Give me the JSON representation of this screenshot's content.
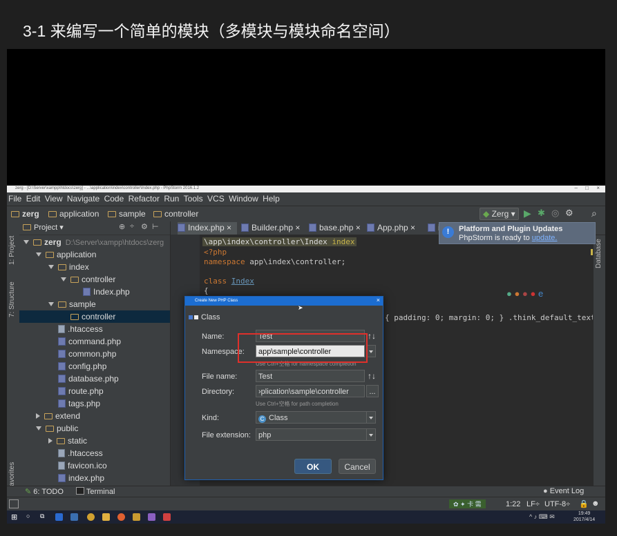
{
  "page_title": "3-1 来编写一个简单的模块（多模块与模块命名空间）",
  "ide": {
    "window_title": "zerg - [D:\\Server\\xampp\\htdocs\\zerg] - ...\\application\\index\\controller\\Index.php - PhpStorm 2016.1.2",
    "menu": [
      "File",
      "Edit",
      "View",
      "Navigate",
      "Code",
      "Refactor",
      "Run",
      "Tools",
      "VCS",
      "Window",
      "Help"
    ],
    "breadcrumb": [
      "zerg",
      "application",
      "sample",
      "controller"
    ],
    "run_config": "Zerg",
    "project_header": "Project",
    "side_tabs": {
      "project": "1: Project",
      "structure": "7: Structure",
      "favorites": "2: Favorites",
      "database": "Database"
    },
    "tree": [
      {
        "label": "zerg",
        "note": "D:\\Server\\xampp\\htdocs\\zerg",
        "kind": "folder",
        "depth": 0,
        "open": true
      },
      {
        "label": "application",
        "kind": "folder",
        "depth": 1,
        "open": true
      },
      {
        "label": "index",
        "kind": "folder",
        "depth": 2,
        "open": true
      },
      {
        "label": "controller",
        "kind": "folder",
        "depth": 3,
        "open": true
      },
      {
        "label": "Index.php",
        "kind": "php",
        "depth": 4
      },
      {
        "label": "sample",
        "kind": "folder",
        "depth": 2,
        "open": true
      },
      {
        "label": "controller",
        "kind": "folder",
        "depth": 3,
        "selected": true
      },
      {
        "label": ".htaccess",
        "kind": "file",
        "depth": 2
      },
      {
        "label": "command.php",
        "kind": "php",
        "depth": 2
      },
      {
        "label": "common.php",
        "kind": "php",
        "depth": 2
      },
      {
        "label": "config.php",
        "kind": "php",
        "depth": 2
      },
      {
        "label": "database.php",
        "kind": "php",
        "depth": 2
      },
      {
        "label": "route.php",
        "kind": "php",
        "depth": 2
      },
      {
        "label": "tags.php",
        "kind": "php",
        "depth": 2
      },
      {
        "label": "extend",
        "kind": "folder",
        "depth": 1,
        "open": false
      },
      {
        "label": "public",
        "kind": "folder",
        "depth": 1,
        "open": true
      },
      {
        "label": "static",
        "kind": "folder",
        "depth": 2,
        "open": false
      },
      {
        "label": ".htaccess",
        "kind": "file",
        "depth": 2
      },
      {
        "label": "favicon.ico",
        "kind": "file",
        "depth": 2
      },
      {
        "label": "index.php",
        "kind": "php",
        "depth": 2
      }
    ],
    "tabs": [
      "Index.php",
      "Builder.php",
      "base.php",
      "App.php",
      "in"
    ],
    "code": {
      "breadcrumb": "\\app\\index\\controller\\Index",
      "breadcrumb_method": "index",
      "line1": "<?php",
      "line2_kw": "namespace",
      "line2_rest": " app\\index\\controller;",
      "line3_kw": "class",
      "line3_name": "Index",
      "line4": "{",
      "css_line": "{ padding: 0; margin: 0; } .think_default_text{ p"
    },
    "notification": {
      "title": "Platform and Plugin Updates",
      "text": "PhpStorm is ready to ",
      "link": "update."
    },
    "dialog": {
      "title": "Create New PHP Class",
      "section": "Class",
      "name_label": "Name:",
      "name_value": "Test",
      "namespace_label": "Namespace:",
      "namespace_value": "app\\sample\\controller",
      "namespace_hint": "Use Ctrl+空格 for namespace completion",
      "filename_label": "File name:",
      "filename_value": "Test",
      "directory_label": "Directory:",
      "directory_value": "›plication\\sample\\controller",
      "directory_btn": "...",
      "directory_hint": "Use Ctrl+空格 for path completion",
      "kind_label": "Kind:",
      "kind_value": "Class",
      "ext_label": "File extension:",
      "ext_value": "php",
      "ok": "OK",
      "cancel": "Cancel"
    },
    "bottom": {
      "todo": "6: TODO",
      "terminal": "Terminal",
      "event_log": "Event Log"
    },
    "status": {
      "position": "1:22",
      "line_sep": "LF÷",
      "encoding": "UTF-8÷"
    },
    "taskbar": {
      "time": "19:49",
      "date": "2017/4/14"
    }
  },
  "colors": {
    "accent": "#1c6dd0",
    "highlight": "#e0302b"
  }
}
